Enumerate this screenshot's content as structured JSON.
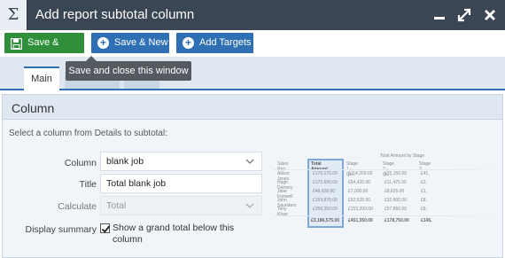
{
  "window": {
    "icon_glyph": "Σ",
    "title": "Add report subtotal column",
    "controls": [
      "minimize-icon",
      "maximize-icon",
      "close-icon"
    ]
  },
  "toolbar": {
    "save_close": "Save & Close",
    "save_new": "Save & New",
    "add_targets": "Add Targets",
    "save_color": "#2f8f3a",
    "primary_color": "#2e70b3"
  },
  "tooltip": "Save and close this window",
  "tabs": [
    {
      "label": "Main",
      "active": true
    }
  ],
  "panel": {
    "title": "Column",
    "instructions": "Select a column from Details to subtotal:"
  },
  "form": {
    "column_label": "Column",
    "column_value": "blank job",
    "title_label": "Title",
    "title_value": "Total blank job",
    "calculate_label": "Calculate",
    "calculate_value": "Total",
    "summary_label": "Display summary",
    "summary_checked": true,
    "summary_text": "Show a grand total below this column"
  },
  "preview": {
    "group_header": "Total Amount by Stage",
    "headers": [
      "Sales Rep",
      "Total Amount",
      "Stage 1 - Qu...",
      "Stage 2 - Qu...",
      "Stage 3"
    ],
    "rows": [
      [
        "Alison Jones",
        "£170,175.00",
        "£114,200.00",
        "£75,150.00",
        "£41,"
      ],
      [
        "Hugh Demery",
        "£170,690.00",
        "£64,425.00",
        "£11,475.00",
        "£2,"
      ],
      [
        "Jane Fretwell",
        "£48,628.00",
        "£7,000.00",
        "£8,625.00",
        "£1,"
      ],
      [
        "John Saunders",
        "£169,875.00",
        "£52,525.00",
        "£32,600.00",
        "£8,"
      ],
      [
        "Tony Khan",
        "£356,350.00",
        "£153,200.00",
        "£57,850.00",
        "£8,"
      ]
    ],
    "total_row": [
      "",
      "£3,186,575.00",
      "£451,350.00",
      "£178,750.00",
      "£145,"
    ]
  }
}
